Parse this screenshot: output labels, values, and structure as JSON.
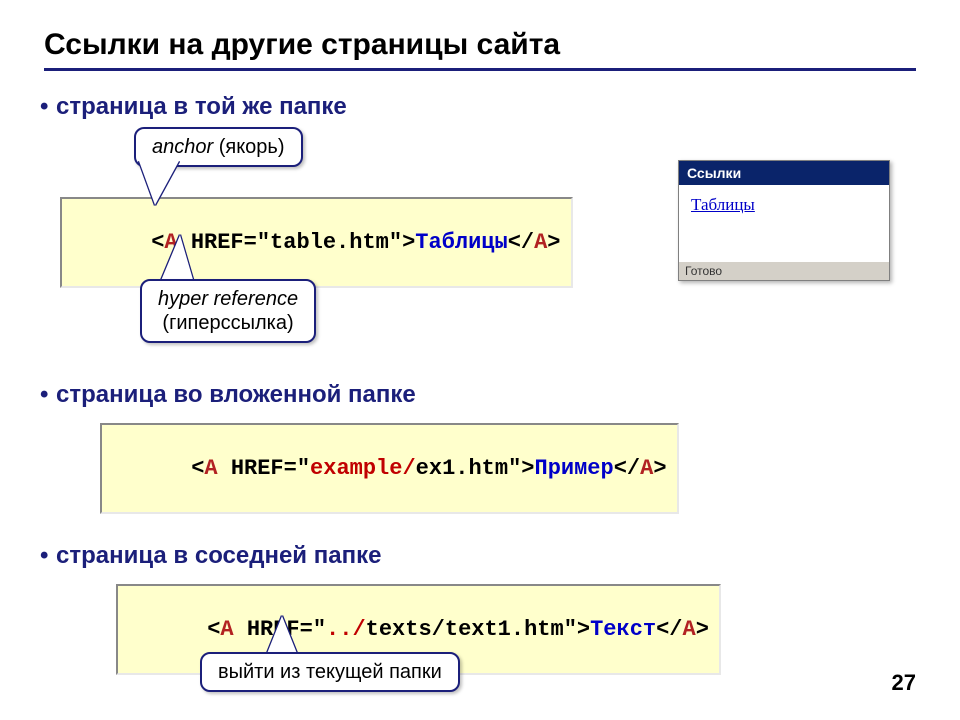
{
  "title": "Ссылки на другие страницы сайта",
  "page_number": "27",
  "bullets": {
    "same_folder": "страница в той же папке",
    "nested_folder": "страница во вложенной папке",
    "sibling_folder": "страница в соседней папке"
  },
  "callouts": {
    "anchor": {
      "em": "anchor",
      "rest": " (якорь)"
    },
    "href": {
      "em": "hyper reference",
      "rest": "(гиперссылка)"
    },
    "upfolder": "выйти из текущей папки"
  },
  "code1": {
    "lt": "<",
    "tag_open": "A",
    "sp1": " ",
    "attr": "HREF=\"table.htm\"",
    "gt": ">",
    "text": "Таблицы",
    "close": "</",
    "tag_close": "A",
    "gt2": ">"
  },
  "code2": {
    "lt": "<",
    "tag_open": "A",
    "sp1": " ",
    "attr_name": "HREF=\"",
    "path": "example/",
    "file": "ex1.htm\"",
    "gt": ">",
    "text": "Пример",
    "close": "</",
    "tag_close": "A",
    "gt2": ">"
  },
  "code3": {
    "lt": "<",
    "tag_open": "A",
    "sp1": " ",
    "attr_name": "HREF=\"",
    "up": "../",
    "path": "texts/text1.htm\"",
    "gt": ">",
    "text": "Текст",
    "close": "</",
    "tag_close": "A",
    "gt2": ">"
  },
  "preview": {
    "title": "Ссылки",
    "link_text": "Таблицы",
    "status": "Готово"
  }
}
